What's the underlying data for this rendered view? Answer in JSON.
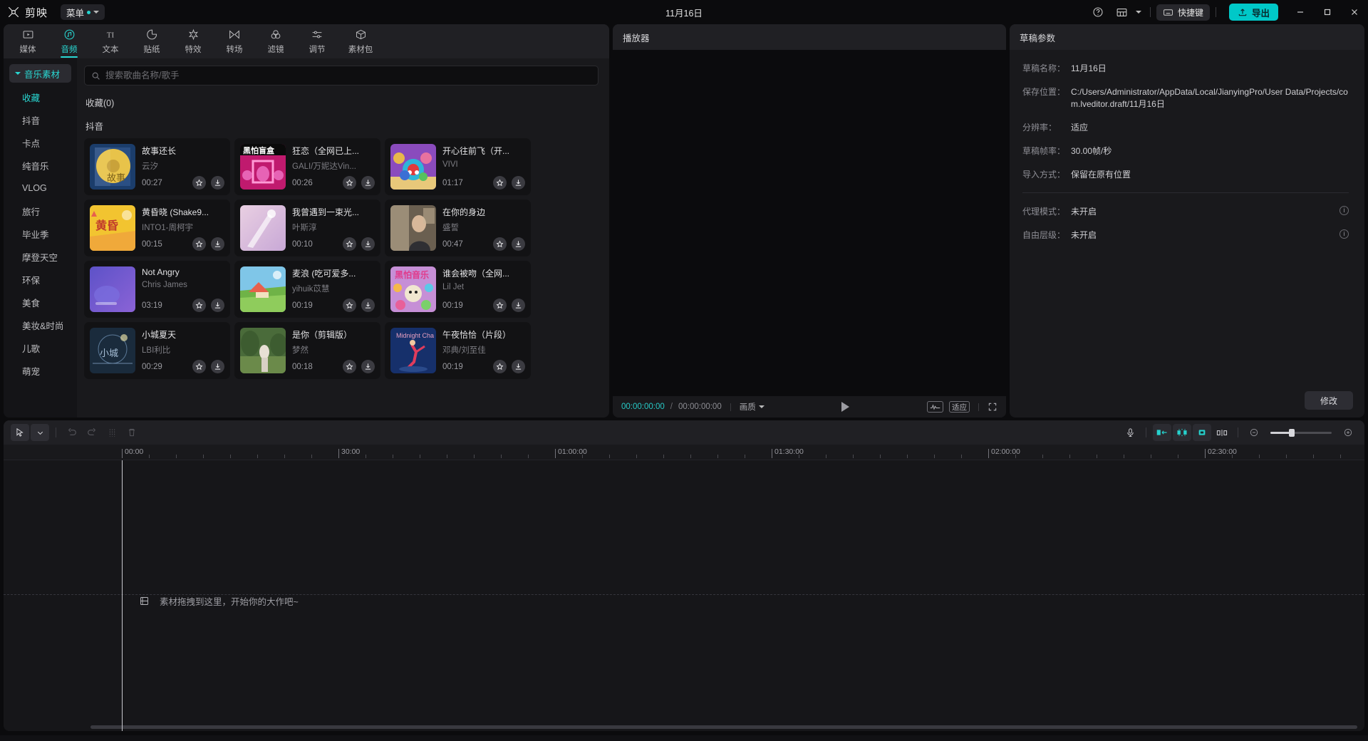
{
  "titlebar": {
    "brand": "剪映",
    "menu_label": "菜单",
    "center_title": "11月16日",
    "help_icon": "help-circle-icon",
    "layout_icon": "layout-icon",
    "shortcut_label": "快捷键",
    "shortcut_icon": "keyboard-icon",
    "export_label": "导出",
    "export_icon": "upload-icon",
    "export_color": "#00c8c8",
    "minimize": "–",
    "maximize": "□",
    "close": "✕"
  },
  "tabs": [
    {
      "label": "媒体",
      "icon": "media-icon",
      "active": false
    },
    {
      "label": "音频",
      "icon": "audio-note-icon",
      "active": true
    },
    {
      "label": "文本",
      "icon": "text-ti-icon",
      "active": false
    },
    {
      "label": "贴纸",
      "icon": "sticker-icon",
      "active": false
    },
    {
      "label": "特效",
      "icon": "effects-star-icon",
      "active": false
    },
    {
      "label": "转场",
      "icon": "transition-icon",
      "active": false
    },
    {
      "label": "滤镜",
      "icon": "filter-circles-icon",
      "active": false
    },
    {
      "label": "调节",
      "icon": "adjust-sliders-icon",
      "active": false
    },
    {
      "label": "素材包",
      "icon": "material-pack-icon",
      "active": false
    }
  ],
  "categories": {
    "root": "音乐素材",
    "items": [
      {
        "label": "收藏",
        "selected": true
      },
      {
        "label": "抖音",
        "selected": false
      },
      {
        "label": "卡点",
        "selected": false
      },
      {
        "label": "纯音乐",
        "selected": false
      },
      {
        "label": "VLOG",
        "selected": false
      },
      {
        "label": "旅行",
        "selected": false
      },
      {
        "label": "毕业季",
        "selected": false
      },
      {
        "label": "摩登天空",
        "selected": false
      },
      {
        "label": "环保",
        "selected": false
      },
      {
        "label": "美食",
        "selected": false
      },
      {
        "label": "美妆&时尚",
        "selected": false
      },
      {
        "label": "儿歌",
        "selected": false
      },
      {
        "label": "萌宠",
        "selected": false
      }
    ]
  },
  "search": {
    "placeholder": "搜索歌曲名称/歌手",
    "value": "",
    "icon": "search-icon"
  },
  "sections": {
    "favorites_title": "收藏(0)",
    "douyin_title": "抖音"
  },
  "songs": [
    {
      "title": "故事还长",
      "artist": "云汐",
      "duration": "00:27",
      "cover": "c1"
    },
    {
      "title": "狂恋（全网已上...",
      "artist": "GALI/万妮达Vin...",
      "duration": "00:26",
      "cover": "c2"
    },
    {
      "title": "开心往前飞（开...",
      "artist": "VIVI",
      "duration": "01:17",
      "cover": "c3"
    },
    {
      "title": "黄昏晓 (Shake9...",
      "artist": "INTO1-周柯宇",
      "duration": "00:15",
      "cover": "c4"
    },
    {
      "title": "我曾遇到一束光...",
      "artist": "叶斯淳",
      "duration": "00:10",
      "cover": "c5"
    },
    {
      "title": "在你的身边",
      "artist": "盛誓",
      "duration": "00:47",
      "cover": "c6"
    },
    {
      "title": "Not Angry",
      "artist": "Chris James",
      "duration": "03:19",
      "cover": "c7"
    },
    {
      "title": "麦浪 (吃可爱多...",
      "artist": "yihuik苡慧",
      "duration": "00:19",
      "cover": "c8"
    },
    {
      "title": "谁会被吻（全网...",
      "artist": "Lil Jet",
      "duration": "00:19",
      "cover": "c9"
    },
    {
      "title": "小城夏天",
      "artist": "LBI利比",
      "duration": "00:29",
      "cover": "c10"
    },
    {
      "title": "是你（剪辑版）",
      "artist": "梦然",
      "duration": "00:18",
      "cover": "c11"
    },
    {
      "title": "午夜恰恰（片段）",
      "artist": "邓典/刘至佳",
      "duration": "00:19",
      "cover": "c12"
    }
  ],
  "card_icons": {
    "favorite": "star-icon",
    "download": "download-icon"
  },
  "player": {
    "title": "播放器",
    "current_time": "00:00:00:00",
    "separator": "/",
    "total_time": "00:00:00:00",
    "quality_label": "画质",
    "play_icon": "play-icon",
    "waveform_icon": "waveform-icon",
    "fit_label": "适应",
    "fullscreen_icon": "fullscreen-icon"
  },
  "draft": {
    "title": "草稿参数",
    "rows": [
      {
        "label": "草稿名称：",
        "value": "11月16日"
      },
      {
        "label": "保存位置：",
        "value": "C:/Users/Administrator/AppData/Local/JianyingPro/User Data/Projects/com.lveditor.draft/11月16日"
      },
      {
        "label": "分辨率：",
        "value": "适应"
      },
      {
        "label": "草稿帧率：",
        "value": "30.00帧/秒"
      },
      {
        "label": "导入方式：",
        "value": "保留在原有位置"
      }
    ],
    "rows2": [
      {
        "label": "代理模式：",
        "value": "未开启",
        "info": true
      },
      {
        "label": "自由层级：",
        "value": "未开启",
        "info": true
      }
    ],
    "modify_label": "修改"
  },
  "timeline": {
    "tools": [
      {
        "name": "select-tool",
        "icon": "cursor-icon",
        "state": "selected"
      },
      {
        "name": "select-dropdown",
        "icon": "chevron-down-icon",
        "state": "selected"
      },
      {
        "name": "undo",
        "icon": "undo-icon",
        "state": "disabled"
      },
      {
        "name": "redo",
        "icon": "redo-icon",
        "state": "disabled"
      },
      {
        "name": "split",
        "icon": "split-icon",
        "state": "disabled"
      },
      {
        "name": "delete",
        "icon": "trash-icon",
        "state": "disabled"
      }
    ],
    "right_tools": [
      {
        "name": "record-audio",
        "icon": "microphone-icon",
        "state": "normal"
      },
      {
        "name": "mirror-left",
        "icon": "clip-left-icon",
        "state": "cyan"
      },
      {
        "name": "auto-snap",
        "icon": "magnet-snap-icon",
        "state": "cyan-active"
      },
      {
        "name": "mirror-right",
        "icon": "clip-right-icon",
        "state": "cyan"
      },
      {
        "name": "keyframe-split",
        "icon": "link-split-icon",
        "state": "normal"
      },
      {
        "name": "zoom-out",
        "icon": "zoom-minus-icon",
        "state": "normal"
      },
      {
        "name": "zoom-in",
        "icon": "zoom-plus-icon",
        "state": "normal"
      }
    ],
    "ruler_labels": [
      "00:00",
      "30:00",
      "01:00:00",
      "01:30:00",
      "02:00:00",
      "02:30:00"
    ],
    "drop_hint": "素材拖拽到这里，开始你的大作吧~",
    "drop_icon": "film-strip-icon"
  }
}
